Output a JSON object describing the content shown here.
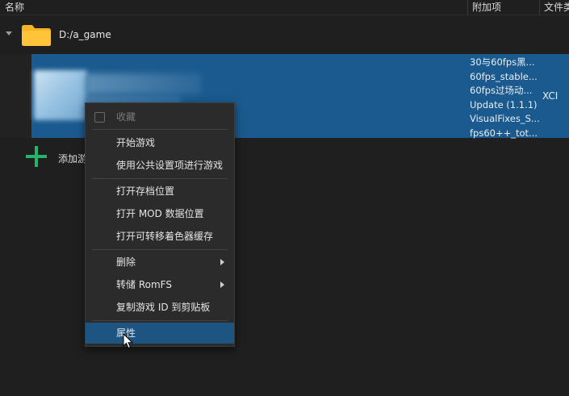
{
  "header": {
    "columns": [
      {
        "label": "名称"
      },
      {
        "label": "附加项"
      },
      {
        "label": "文件类"
      }
    ]
  },
  "folder": {
    "path": "D:/a_game",
    "expanded": true,
    "icon": "folder-icon",
    "color": "#f6b325"
  },
  "game": {
    "selected": true,
    "addons": [
      "30与60fps黑...",
      "60fps_stable...",
      "60fps过场动...",
      "Update (1.1.1)",
      "VisualFixes_S...",
      "fps60++_tot..."
    ],
    "file_type": "XCI",
    "selection_color": "#1b5a8e"
  },
  "add_game": {
    "label": "添加游",
    "icon": "plus-icon",
    "color": "#24b36b"
  },
  "context_menu": {
    "items": [
      {
        "label": "收藏",
        "disabled": true,
        "checkbox": true
      },
      {
        "label": "开始游戏"
      },
      {
        "label": "使用公共设置项进行游戏"
      },
      {
        "label": "打开存档位置"
      },
      {
        "label": "打开 MOD 数据位置"
      },
      {
        "label": "打开可转移着色器缓存"
      },
      {
        "label": "删除",
        "submenu": true
      },
      {
        "label": "转储 RomFS",
        "submenu": true
      },
      {
        "label": "复制游戏 ID 到剪贴板"
      },
      {
        "label": "属性",
        "highlighted": true
      }
    ]
  }
}
